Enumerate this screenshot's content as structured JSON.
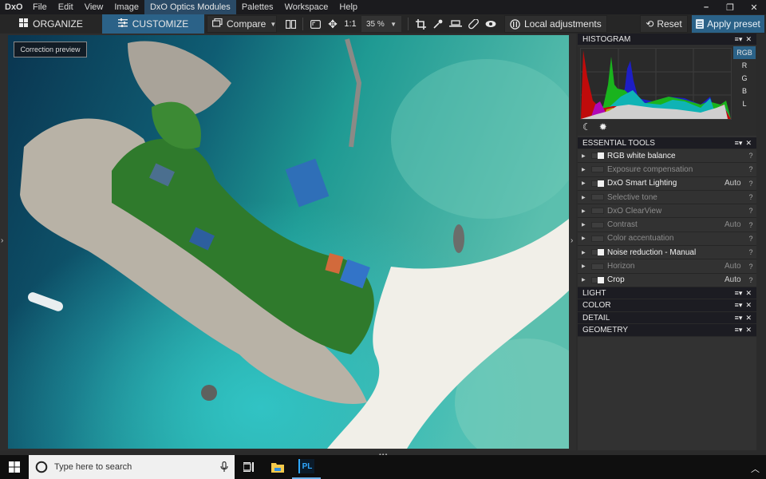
{
  "app": {
    "logo": "DxO"
  },
  "menu": [
    {
      "label": "File"
    },
    {
      "label": "Edit"
    },
    {
      "label": "View"
    },
    {
      "label": "Image"
    },
    {
      "label": "DxO Optics Modules",
      "active": true
    },
    {
      "label": "Palettes"
    },
    {
      "label": "Workspace"
    },
    {
      "label": "Help"
    }
  ],
  "window_controls": {
    "minimize": "–",
    "restore": "❐",
    "close": "✕"
  },
  "toolbar": {
    "organize_label": "ORGANIZE",
    "customize_label": "CUSTOMIZE",
    "compare_label": "Compare",
    "one_to_one_label": "1:1",
    "zoom_value": "35 %",
    "local_adjustments_label": "Local adjustments",
    "reset_label": "Reset",
    "apply_preset_label": "Apply preset"
  },
  "viewer": {
    "correction_preview_label": "Correction preview"
  },
  "histogram": {
    "title": "HISTOGRAM",
    "channels": [
      "RGB",
      "R",
      "G",
      "B",
      "L"
    ],
    "active_channel": "RGB"
  },
  "essential_tools": {
    "title": "ESSENTIAL TOOLS",
    "items": [
      {
        "label": "RGB white balance",
        "enabled": true,
        "auto": "",
        "help": "?"
      },
      {
        "label": "Exposure compensation",
        "enabled": false,
        "auto": "",
        "help": "?"
      },
      {
        "label": "DxO Smart Lighting",
        "enabled": true,
        "auto": "Auto",
        "help": "?"
      },
      {
        "label": "Selective tone",
        "enabled": false,
        "auto": "",
        "help": "?"
      },
      {
        "label": "DxO ClearView",
        "enabled": false,
        "auto": "",
        "help": "?"
      },
      {
        "label": "Contrast",
        "enabled": false,
        "auto": "Auto",
        "help": "?"
      },
      {
        "label": "Color accentuation",
        "enabled": false,
        "auto": "",
        "help": "?"
      },
      {
        "label": "Noise reduction - Manual",
        "enabled": true,
        "auto": "",
        "help": "?"
      },
      {
        "label": "Horizon",
        "enabled": false,
        "auto": "Auto",
        "help": "?"
      },
      {
        "label": "Crop",
        "enabled": true,
        "auto": "Auto",
        "help": "?"
      }
    ]
  },
  "palettes": [
    {
      "title": "LIGHT"
    },
    {
      "title": "COLOR"
    },
    {
      "title": "DETAIL"
    },
    {
      "title": "GEOMETRY"
    }
  ],
  "taskbar": {
    "search_placeholder": "Type here to search",
    "pinned_app_label": "PL"
  }
}
